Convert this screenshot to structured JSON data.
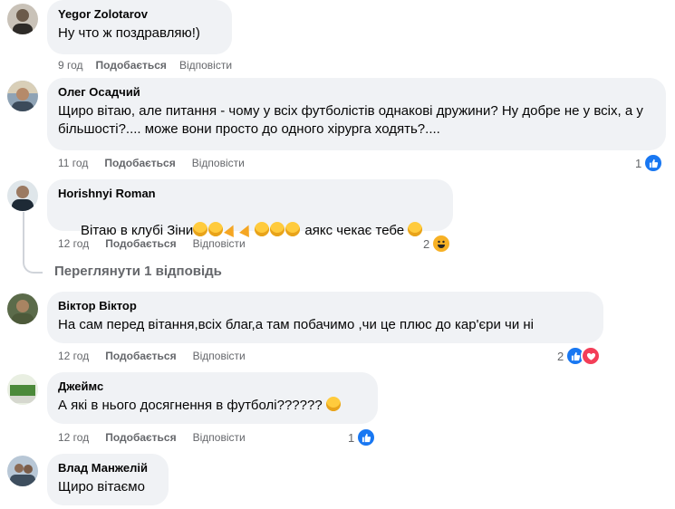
{
  "comments": [
    {
      "author": "Yegor Zolotarov",
      "text": "Ну что ж поздравляю!)",
      "time": "9 год",
      "like": "Подобається",
      "reply": "Відповісти",
      "reactions": null
    },
    {
      "author": "Олег Осадчий",
      "text": "Щиро вітаю, але питання - чому у всіх футболістів однакові дружини? Ну добре не у всіх, а у більшості?.... може вони просто до одного хірурга ходять?....",
      "time": "11 год",
      "like": "Подобається",
      "reply": "Відповісти",
      "reactions": {
        "count": "1",
        "icons": [
          "like"
        ]
      }
    },
    {
      "author": "Horishnyi Roman",
      "text_before": "Вітаю в клубі Зіни",
      "text_after": " аякс чекає тебе",
      "time": "12 год",
      "like": "Подобається",
      "reply": "Відповісти",
      "reactions": {
        "count": "2",
        "icons": [
          "haha"
        ]
      },
      "view_replies": "Переглянути 1 відповідь"
    },
    {
      "author": "Віктор Віктор",
      "text": "На сам перед вітання,всіх благ,а там побачимо ,чи це плюс до кар'єри чи ні",
      "time": "12 год",
      "like": "Подобається",
      "reply": "Відповісти",
      "reactions": {
        "count": "2",
        "icons": [
          "like",
          "love"
        ]
      }
    },
    {
      "author": "Джеймс",
      "text": "А які в нього досягнення в футболі?????? ",
      "time": "12 год",
      "like": "Подобається",
      "reply": "Відповісти",
      "reactions": {
        "count": "1",
        "icons": [
          "like"
        ]
      }
    },
    {
      "author": "Влад Манжелій",
      "text": "Щиро вітаємо",
      "time": null,
      "like": null,
      "reply": null,
      "reactions": null
    }
  ],
  "colors": {
    "bubble": "#f0f2f5",
    "meta": "#65676b",
    "like_blue": "#1877f2",
    "love_red": "#f33e58"
  }
}
